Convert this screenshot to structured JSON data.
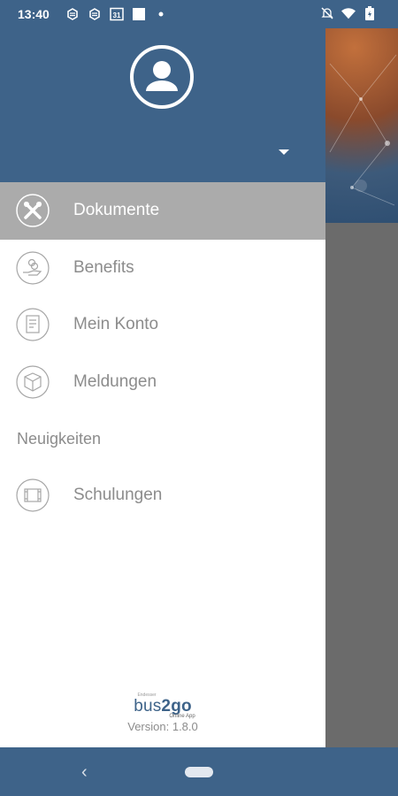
{
  "status_bar": {
    "time": "13:40",
    "calendar_day": "31"
  },
  "drawer": {
    "menu": [
      {
        "label": "Dokumente",
        "icon": "tools-icon",
        "active": true
      },
      {
        "label": "Benefits",
        "icon": "hand-coin-icon",
        "active": false
      },
      {
        "label": "Mein Konto",
        "icon": "account-document-icon",
        "active": false
      },
      {
        "label": "Meldungen",
        "icon": "box-icon",
        "active": false
      }
    ],
    "section_label": "Neuigkeiten",
    "section_items": [
      {
        "label": "Schulungen",
        "icon": "film-icon",
        "active": false
      }
    ]
  },
  "footer": {
    "logo_prefix": "Endesser",
    "logo_text_light": "bus",
    "logo_text_bold": "2go",
    "logo_sub": "Online App",
    "version": "Version: 1.8.0"
  },
  "colors": {
    "primary": "#3e6389",
    "active_item_bg": "#ababab",
    "text_gray": "#8c8c8c"
  }
}
